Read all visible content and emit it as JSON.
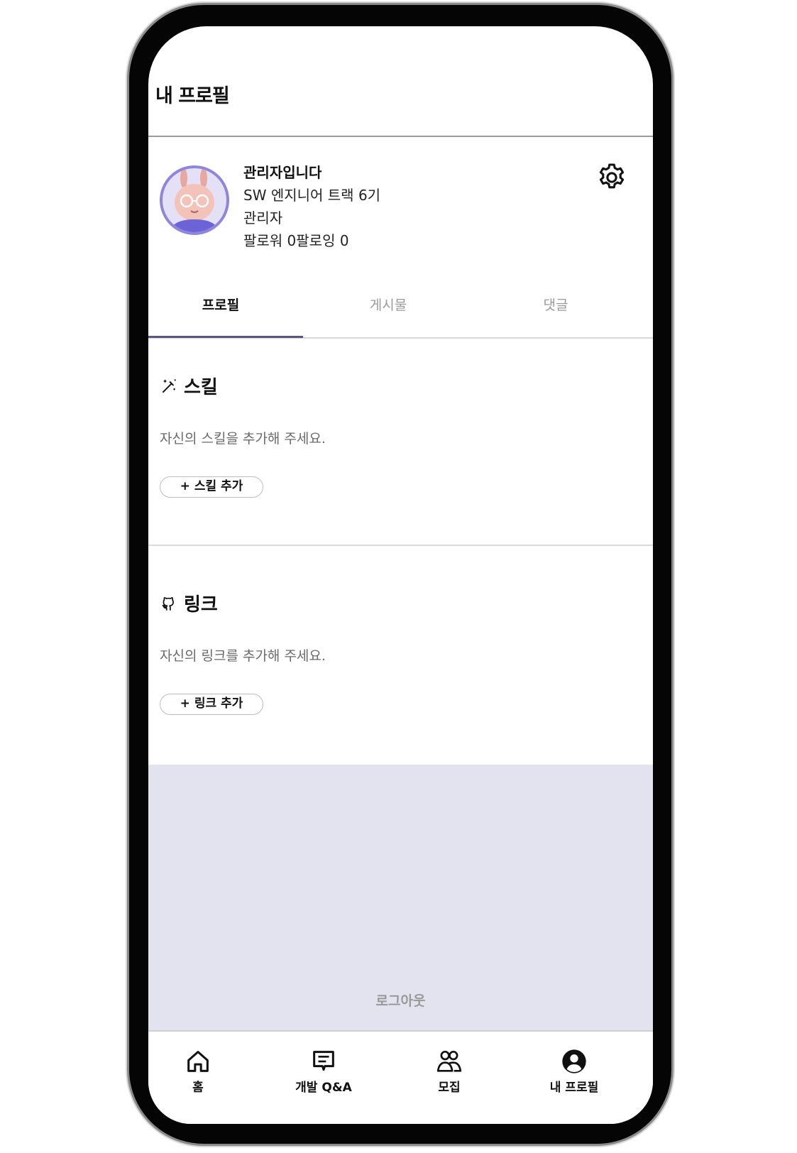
{
  "header": {
    "title": "내 프로필"
  },
  "profile": {
    "name": "관리자입니다",
    "track": "SW 엔지니어 트랙 6기",
    "role": "관리자",
    "follow": "팔로워 0팔로잉 0",
    "settings_icon": "gear-icon"
  },
  "tabs": [
    {
      "label": "프로필",
      "active": true
    },
    {
      "label": "게시물",
      "active": false
    },
    {
      "label": "댓글",
      "active": false
    }
  ],
  "skills": {
    "title": "스킬",
    "icon": "magic-wand-icon",
    "description": "자신의 스킬을 추가해 주세요.",
    "add_button": "+ 스킬 추가"
  },
  "links": {
    "title": "링크",
    "icon": "github-icon",
    "description": "자신의 링크를 추가해 주세요.",
    "add_button": "+ 링크 추가"
  },
  "logout": "로그아웃",
  "nav": [
    {
      "label": "홈",
      "icon": "home-icon"
    },
    {
      "label": "개발 Q&A",
      "icon": "chat-icon"
    },
    {
      "label": "모집",
      "icon": "people-icon"
    },
    {
      "label": "내 프로필",
      "icon": "user-icon"
    }
  ],
  "colors": {
    "accent": "#5a5585",
    "avatar_border": "#8f86dc",
    "footer_bg": "#e2e3ef"
  }
}
